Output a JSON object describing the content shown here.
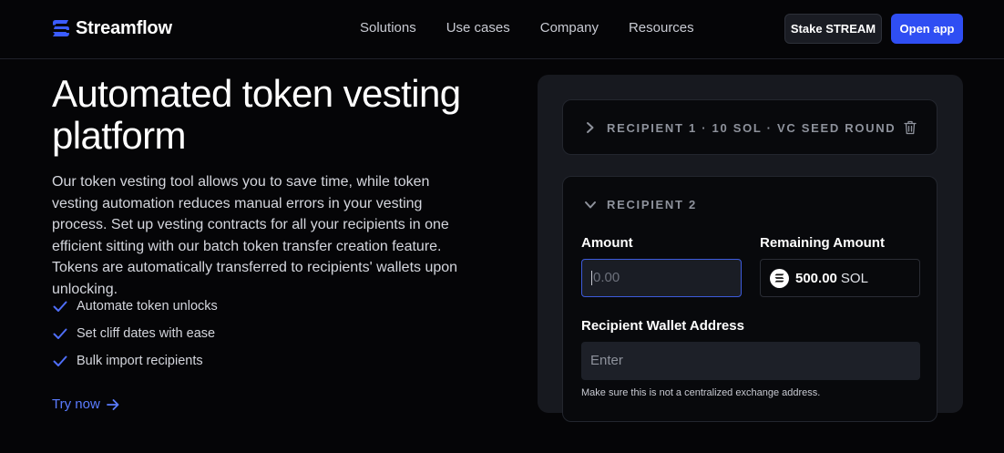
{
  "brand": {
    "name": "Streamflow"
  },
  "nav": [
    "Solutions",
    "Use cases",
    "Company",
    "Resources"
  ],
  "actions": {
    "stake": "Stake STREAM",
    "open": "Open app"
  },
  "hero": {
    "title_line1": "Automated token vesting",
    "title_line2": "platform",
    "description": "Our token vesting tool allows you to save time, while token vesting automation reduces manual errors in your vesting process. Set up vesting contracts for all your recipients in one efficient sitting with our batch token transfer creation feature. Tokens are automatically transferred to recipients' wallets upon unlocking.",
    "features": [
      "Automate token unlocks",
      "Set cliff dates with ease",
      "Bulk import recipients"
    ],
    "cta": "Try now"
  },
  "form": {
    "recipient1": {
      "label": "RECIPIENT 1 · 10 SOL · VC SEED ROUND",
      "icon": "trash-icon"
    },
    "recipient2": {
      "label": "RECIPIENT 2",
      "amount_label": "Amount",
      "amount_placeholder": "0.00",
      "remaining_label": "Remaining Amount",
      "remaining_value": "500.00",
      "remaining_unit": "SOL",
      "wallet_label": "Recipient Wallet Address",
      "wallet_placeholder": "Enter",
      "hint": "Make sure this is not a centralized exchange address."
    }
  },
  "colors": {
    "accent": "#2f4ef3",
    "link": "#5b7cff",
    "background": "#050507",
    "panel": "#17191f"
  }
}
